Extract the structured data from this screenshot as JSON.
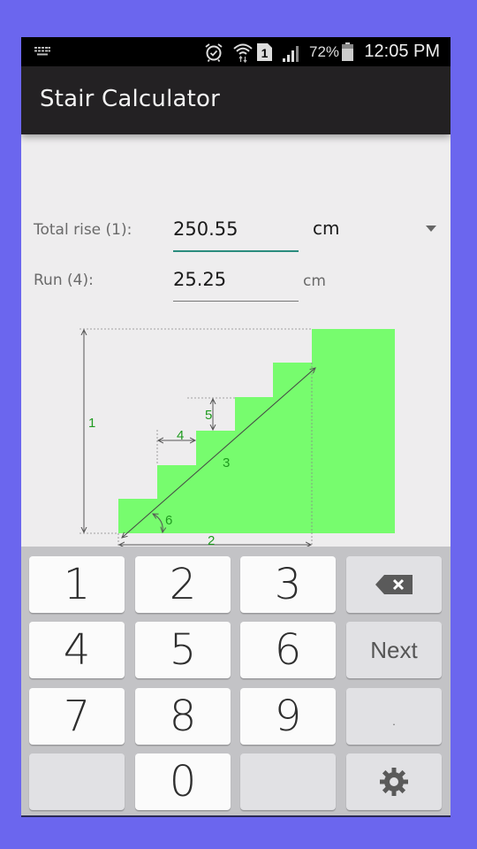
{
  "status_bar": {
    "icons": [
      "keyboard-icon",
      "alarm-icon",
      "wifi-icon",
      "sim-1-icon",
      "signal-icon",
      "battery-icon"
    ],
    "sim_label": "1",
    "battery_percent": "72%",
    "time": "12:05 PM"
  },
  "app_bar": {
    "title": "Stair Calculator"
  },
  "form": {
    "total_rise": {
      "label": "Total rise (1):",
      "value": "250.55",
      "focused": true,
      "accent_color": "#2a8c7e"
    },
    "unit_select": {
      "selected": "cm"
    },
    "run": {
      "label": "Run (4):",
      "value": "25.25",
      "unit": "cm"
    }
  },
  "diagram": {
    "labels": {
      "total_rise": "1",
      "total_run": "2",
      "stringer_length": "3",
      "run": "4",
      "rise": "5",
      "angle": "6"
    },
    "fill_color": "#77fc6e",
    "label_color": "#1f9a1f"
  },
  "keyboard": {
    "rows": [
      [
        {
          "label": "1",
          "type": "digit"
        },
        {
          "label": "2",
          "type": "digit"
        },
        {
          "label": "3",
          "type": "digit"
        },
        {
          "label": "",
          "type": "backspace",
          "icon": "backspace-icon"
        }
      ],
      [
        {
          "label": "4",
          "type": "digit"
        },
        {
          "label": "5",
          "type": "digit"
        },
        {
          "label": "6",
          "type": "digit"
        },
        {
          "label": "Next",
          "type": "action"
        }
      ],
      [
        {
          "label": "7",
          "type": "digit"
        },
        {
          "label": "8",
          "type": "digit"
        },
        {
          "label": "9",
          "type": "digit"
        },
        {
          "label": ".",
          "type": "symbol"
        }
      ],
      [
        {
          "label": "",
          "type": "blank"
        },
        {
          "label": "0",
          "type": "digit"
        },
        {
          "label": "",
          "type": "blank"
        },
        {
          "label": "",
          "type": "settings",
          "icon": "gear-icon"
        }
      ]
    ]
  }
}
